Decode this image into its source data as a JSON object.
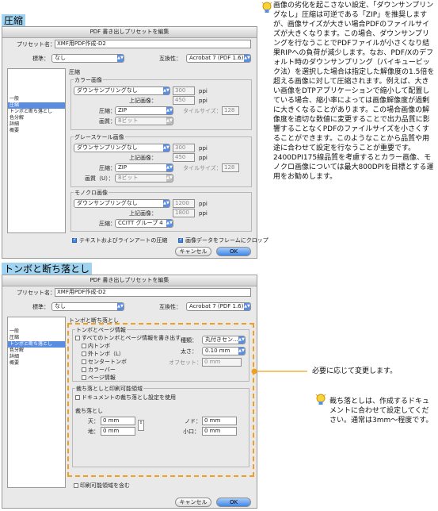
{
  "sections": {
    "compression_title": "圧縮",
    "marks_title": "トンボと断ち落とし"
  },
  "dialog1": {
    "title": "PDF 書き出しプリセットを編集",
    "preset_label": "プリセット名：",
    "preset_value": "XMF用PDF作成-D2",
    "standard_label": "標準：",
    "standard_value": "なし",
    "compat_label": "互換性：",
    "compat_value": "Acrobat 7 (PDF 1.6)",
    "sidebar": [
      "一般",
      "圧縮",
      "トンボと断ち落とし",
      "色分解",
      "詳細",
      "概要"
    ],
    "sidebar_selected": 1,
    "panel_heading": "圧縮",
    "color": {
      "heading": "カラー画像",
      "downsample": "ダウンサンプリングなし",
      "res_value": "300",
      "res_unit": "ppi",
      "above_label": "上記画像：",
      "above_value": "450",
      "above_unit": "ppi",
      "comp_label": "圧縮：",
      "comp_value": "ZIP",
      "tile_label": "タイルサイズ：",
      "tile_value": "128",
      "quality_label": "画質：",
      "quality_value": "8ビット"
    },
    "gray": {
      "heading": "グレースケール画像",
      "downsample": "ダウンサンプリングなし",
      "res_value": "300",
      "res_unit": "ppi",
      "above_label": "上記画像：",
      "above_value": "450",
      "above_unit": "ppi",
      "comp_label": "圧縮：",
      "comp_value": "ZIP",
      "tile_label": "タイルサイズ：",
      "tile_value": "128",
      "quality_label": "画質（U）：",
      "quality_value": "8ビット"
    },
    "mono": {
      "heading": "モノクロ画像",
      "downsample": "ダウンサンプリングなし",
      "res_value": "1200",
      "res_unit": "ppi",
      "above_label": "上記画像：",
      "above_value": "1800",
      "above_unit": "ppi",
      "comp_label": "圧縮：",
      "comp_value": "CCITT グループ 4"
    },
    "text_compress": "テキストおよびラインアートの圧縮",
    "crop_image": "画像データをフレームにクロップ",
    "cancel": "キャンセル",
    "ok": "OK"
  },
  "dialog2": {
    "title": "PDF 書き出しプリセットを編集",
    "preset_label": "プリセット名：",
    "preset_value": "XMF用PDF作成-D2",
    "standard_label": "標準：",
    "standard_value": "なし",
    "compat_label": "互換性：",
    "compat_value": "Acrobat 7 (PDF 1.6)",
    "sidebar": [
      "一般",
      "圧縮",
      "トンボと断ち落とし",
      "色分解",
      "詳細",
      "概要"
    ],
    "sidebar_selected": 2,
    "panel_heading": "トンボと断ち落とし",
    "marks_heading": "トンボとページ情報",
    "all_marks": "すべてのトンボとページ情報を書き出す",
    "marks": [
      "内トンボ",
      "外トンボ（L）",
      "センタートンボ",
      "カラーバー",
      "ページ情報"
    ],
    "type_label": "種類：",
    "type_value": "丸付きセン...",
    "weight_label": "太さ：",
    "weight_value": "0.10 mm",
    "offset_label": "オフセット：",
    "offset_value": "0 mm",
    "bleed_heading": "裁ち落としと印刷可能領域",
    "use_doc_bleed": "ドキュメントの裁ち落とし設定を使用",
    "bleed_sub": "裁ち落とし",
    "top_label": "天：",
    "top_value": "0 mm",
    "bottom_label": "地：",
    "bottom_value": "0 mm",
    "inside_label": "ノド：",
    "inside_value": "0 mm",
    "outside_label": "小口：",
    "outside_value": "0 mm",
    "include_slug": "印刷可能領域を含む",
    "cancel": "キャンセル",
    "ok": "OK"
  },
  "notes": {
    "compression_text": "画像の劣化を起こさない設定、「ダウンサンプリングなし」圧縮は可逆である「ZIP」を推奨しますが、画像サイズが大きい場合PDFのファイルサイズが大きくなります。この場合、ダウンサンプリングを行なうことでPDFファイルが小さくなり結果RIPへの負荷が減少します。なお、PDF/Xのデフォルト時のダウンサンプリング（バイキュービック法）を選択した場合は指定した解像度の1.5倍を超える画像に対して圧縮されます。例えば、大きい画像をDTPアプリケーションで縮小して配置している場合、縮小率によっては画像解像度が過剰に大きくなることがあります。この場合画像の解像度を適切な数値に変更することで出力品質に影響することなくPDFのファイルサイズを小さくすることができます。このようなことから品質や用途に合わせて設定を行なうことが重要です。2400DPI175線品質を考慮するとカラー画像、モノクロ画像については最大800DPIを目標とする運用をお勧めします。",
    "change_text": "必要に応じて変更します。",
    "bleed_text": "裁ち落としは、作成するドキュメントに合わせて設定してください。通常は3mm〜程度です。"
  },
  "colors": {
    "accent": "#3f86e8",
    "title_bg": "#9fd3f0",
    "highlight_orange": "#f0a020"
  }
}
